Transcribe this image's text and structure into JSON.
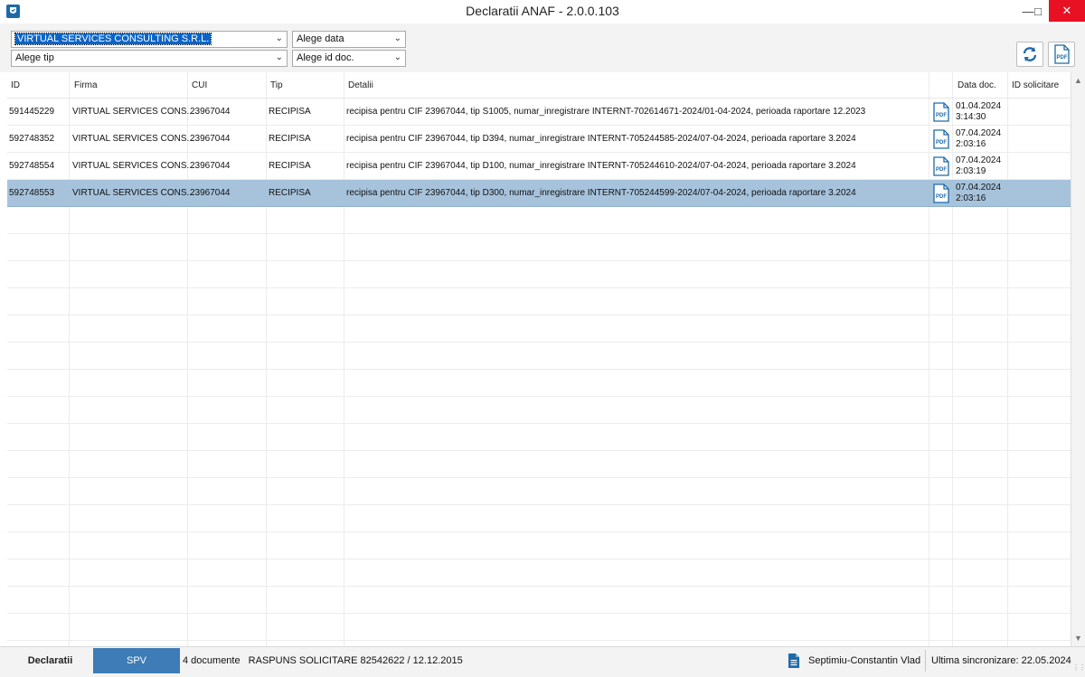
{
  "window": {
    "title": "Declaratii ANAF - 2.0.0.103",
    "minimize": "—",
    "maximize": "□",
    "close": "✕"
  },
  "filters": {
    "firma": "VIRTUAL SERVICES CONSULTING S.R.L.",
    "data": "Alege data",
    "tip": "Alege tip",
    "id_doc": "Alege id doc."
  },
  "toolbar": {
    "refresh_icon": "refresh-icon",
    "pdf_icon": "pdf-icon"
  },
  "table": {
    "columns": [
      "ID",
      "Firma",
      "CUI",
      "Tip",
      "Detalii",
      "Data doc.",
      "ID solicitare"
    ],
    "rows": [
      {
        "id": "591445229",
        "firma": "VIRTUAL SERVICES CONS...",
        "cui": "23967044",
        "tip": "RECIPISA",
        "detalii": "recipisa pentru CIF 23967044, tip S1005, numar_inregistrare INTERNT-702614671-2024/01-04-2024, perioada raportare 12.2023",
        "date": "01.04.2024",
        "time": "3:14:30",
        "id_solicitare": "",
        "selected": false
      },
      {
        "id": "592748352",
        "firma": "VIRTUAL SERVICES CONS...",
        "cui": "23967044",
        "tip": "RECIPISA",
        "detalii": "recipisa pentru CIF 23967044, tip D394, numar_inregistrare INTERNT-705244585-2024/07-04-2024, perioada raportare 3.2024",
        "date": "07.04.2024",
        "time": "2:03:16",
        "id_solicitare": "",
        "selected": false
      },
      {
        "id": "592748554",
        "firma": "VIRTUAL SERVICES CONS...",
        "cui": "23967044",
        "tip": "RECIPISA",
        "detalii": "recipisa pentru CIF 23967044, tip D100, numar_inregistrare INTERNT-705244610-2024/07-04-2024, perioada raportare 3.2024",
        "date": "07.04.2024",
        "time": "2:03:19",
        "id_solicitare": "",
        "selected": false
      },
      {
        "id": "592748553",
        "firma": "VIRTUAL SERVICES CONS...",
        "cui": "23967044",
        "tip": "RECIPISA",
        "detalii": "recipisa pentru CIF 23967044, tip D300, numar_inregistrare INTERNT-705244599-2024/07-04-2024, perioada raportare 3.2024",
        "date": "07.04.2024",
        "time": "2:03:16",
        "id_solicitare": "",
        "selected": true
      }
    ]
  },
  "statusbar": {
    "tab_declaratii": "Declaratii",
    "tab_spv": "SPV",
    "doc_count": "4 documente",
    "raspuns": "RASPUNS SOLICITARE 82542622 / 12.12.2015",
    "user": "Septimiu-Constantin Vlad",
    "last_sync": "Ultima sincronizare: 22.05.2024"
  },
  "colors": {
    "selected_row": "#a7c3dc",
    "spv_tab": "#3d7cb6",
    "close_button": "#e81123",
    "icon_blue": "#1e6aa8"
  }
}
